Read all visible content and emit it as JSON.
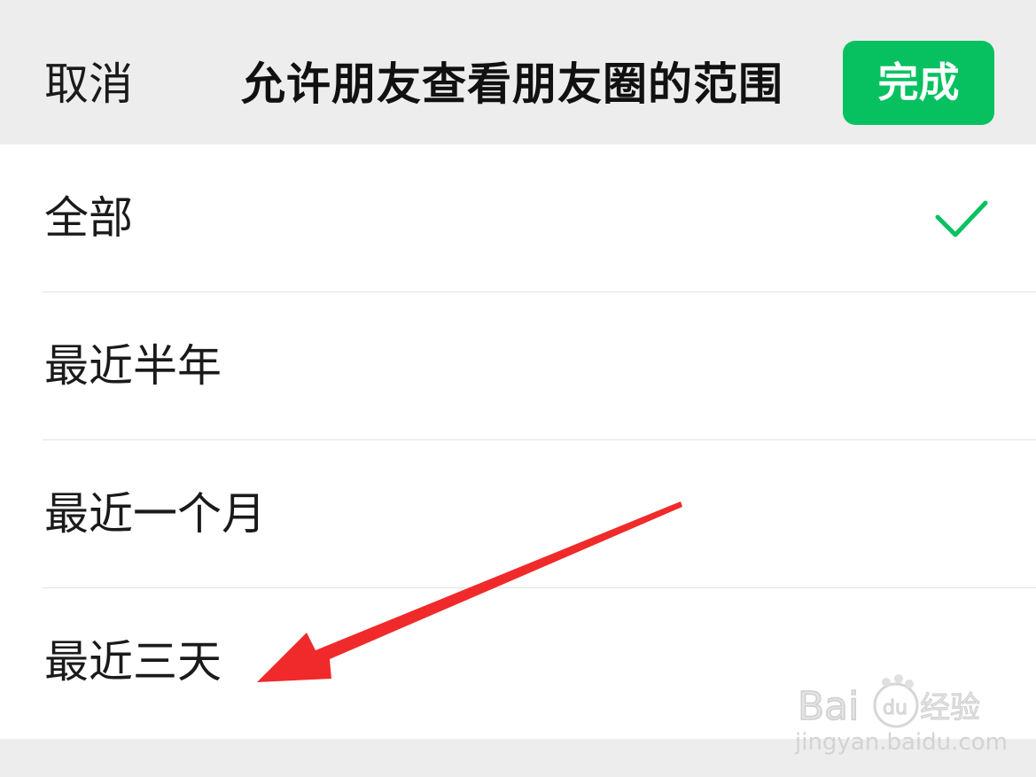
{
  "header": {
    "cancel_label": "取消",
    "title": "允许朋友查看朋友圈的范围",
    "done_label": "完成"
  },
  "options": [
    {
      "label": "全部",
      "selected": true
    },
    {
      "label": "最近半年",
      "selected": false
    },
    {
      "label": "最近一个月",
      "selected": false
    },
    {
      "label": "最近三天",
      "selected": false
    }
  ],
  "annotation": {
    "arrow_color": "#f02a2a",
    "points_to": "最近三天"
  },
  "watermark": {
    "logo_text": "Bai du 经验",
    "url": "jingyan.baidu.com"
  },
  "colors": {
    "accent": "#07c160",
    "background": "#ededed",
    "list_background": "#ffffff"
  },
  "icons": {
    "selected": "check-icon"
  }
}
